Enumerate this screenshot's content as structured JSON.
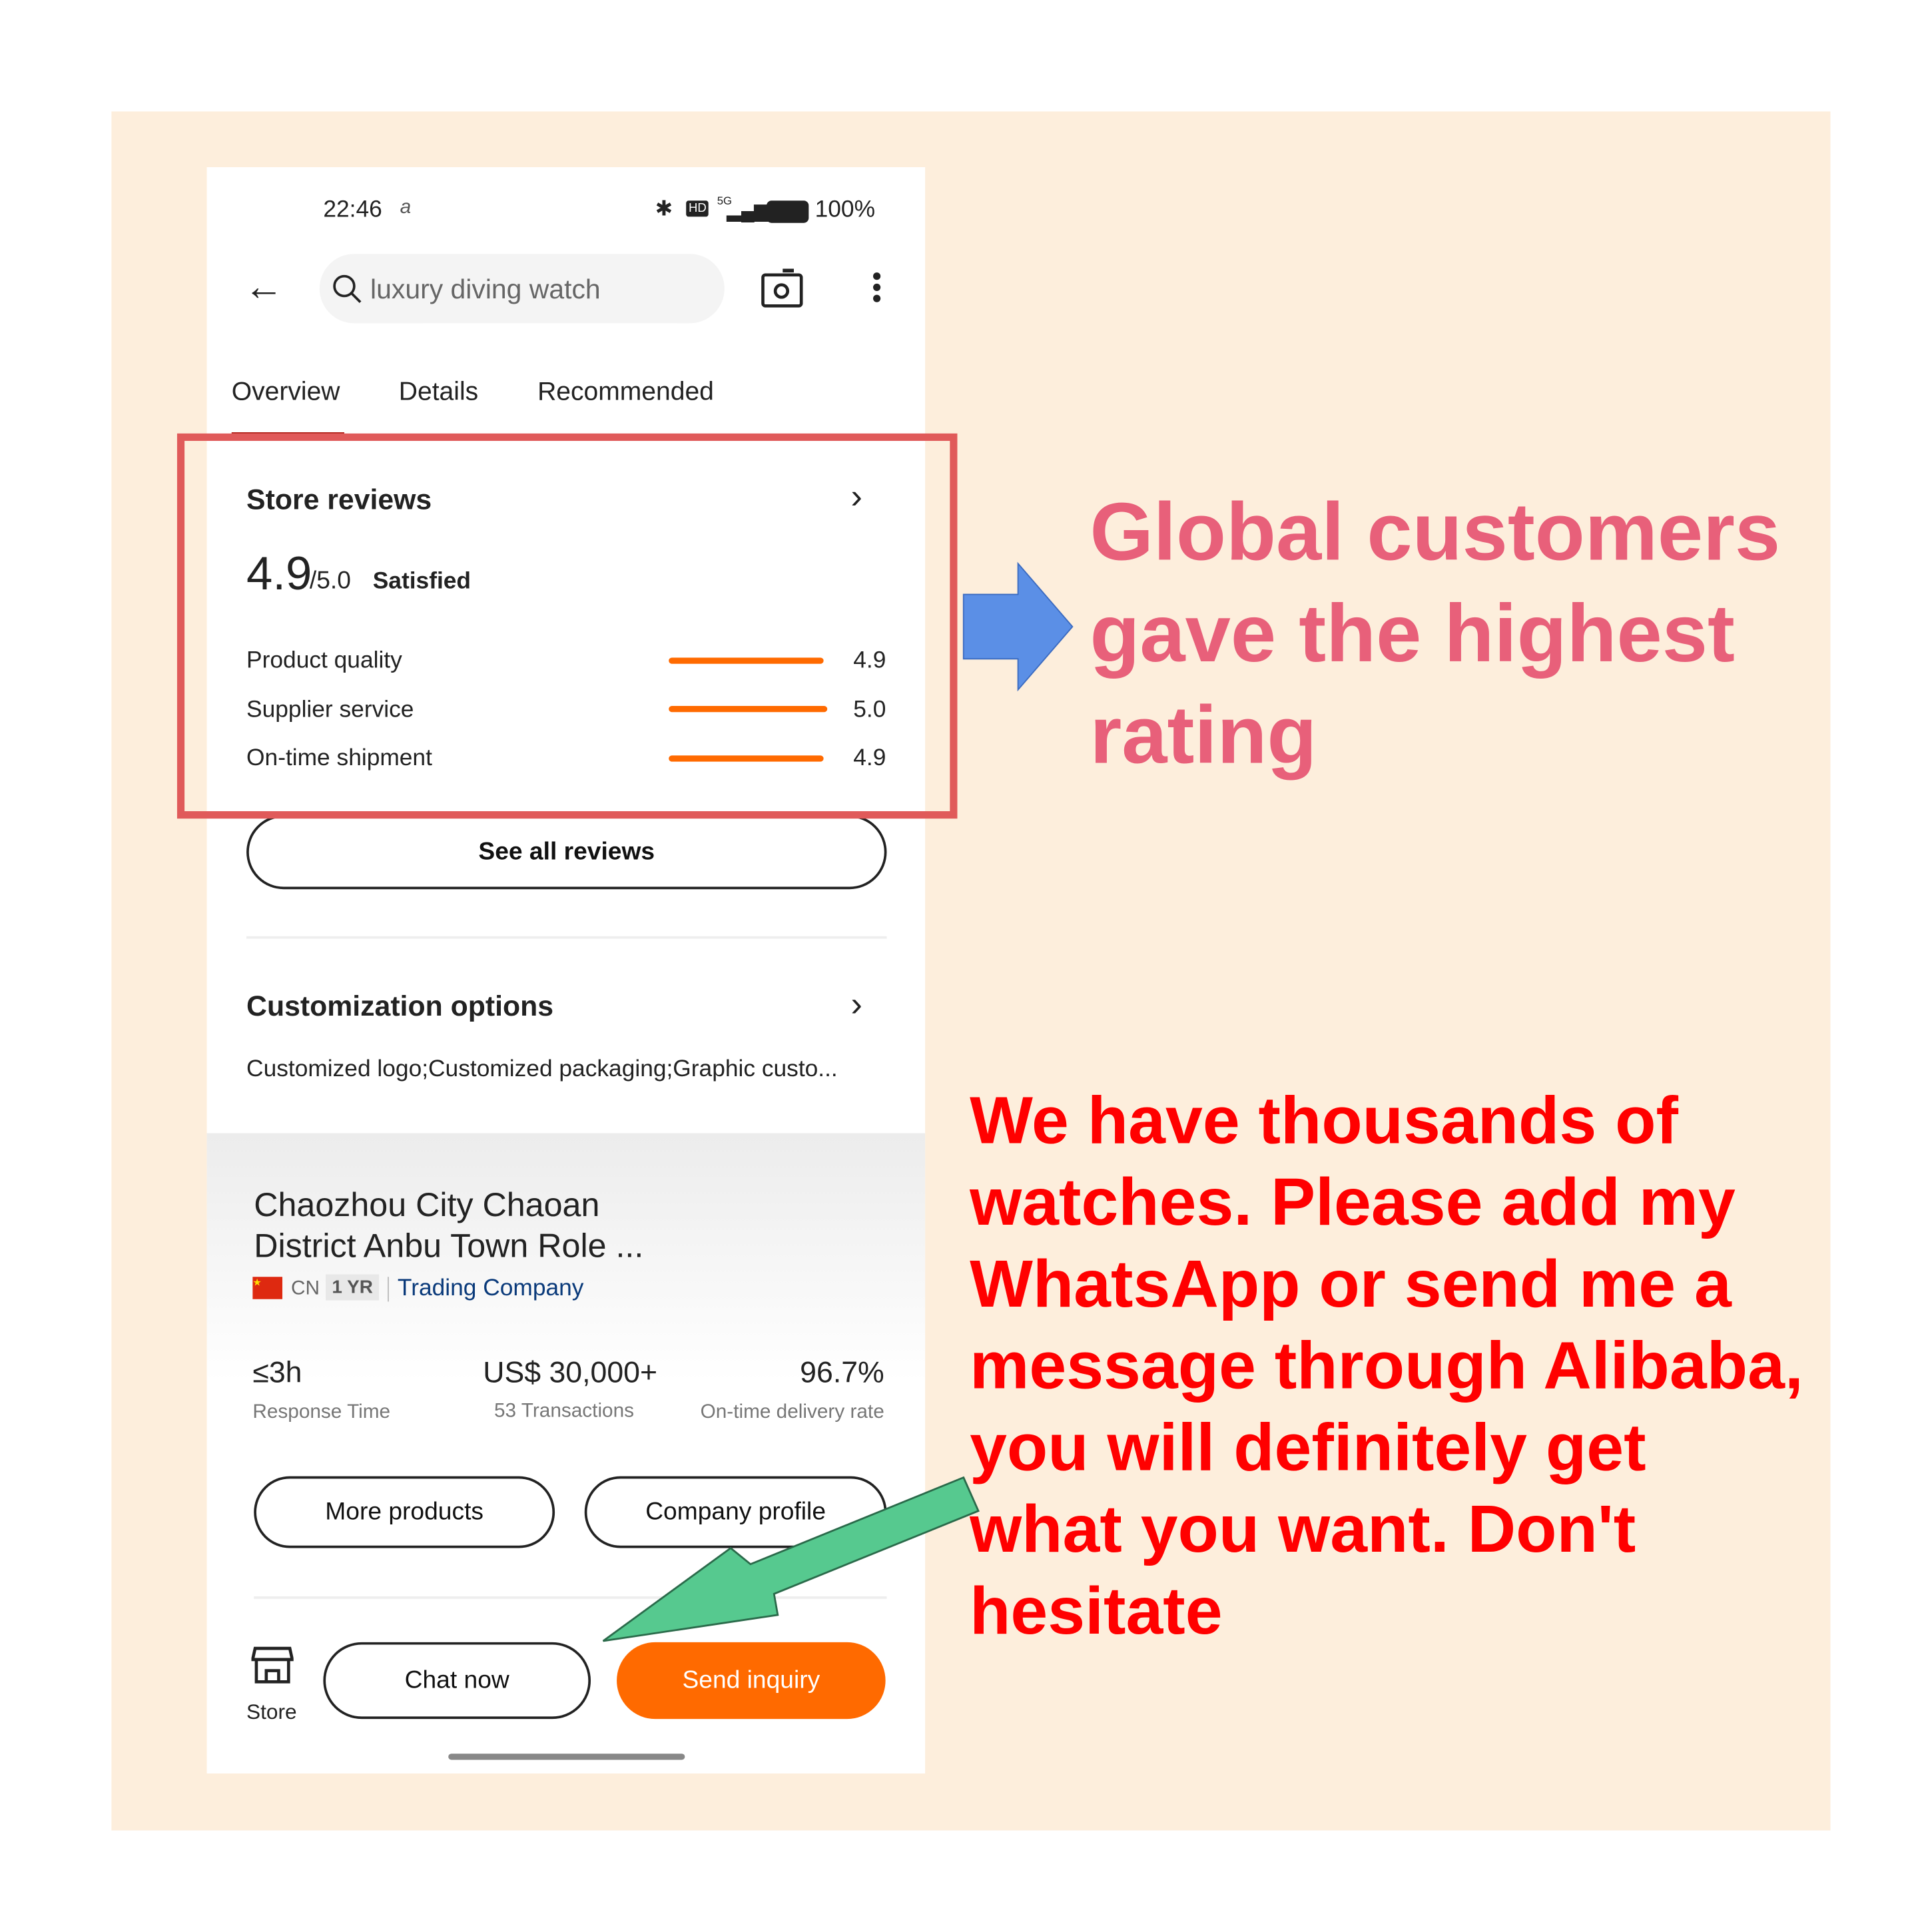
{
  "status": {
    "time": "22:46",
    "carrier_glyph": "a",
    "network": "5G",
    "battery": "100%"
  },
  "search": {
    "value": "luxury diving watch"
  },
  "tabs": [
    {
      "label": "Overview",
      "active": true
    },
    {
      "label": "Details"
    },
    {
      "label": "Recommended"
    }
  ],
  "reviews": {
    "title": "Store reviews",
    "score": "4.9",
    "max": "/5.0",
    "verdict": "Satisfied",
    "rows": [
      {
        "label": "Product quality",
        "value": "4.9",
        "fill": 0.98
      },
      {
        "label": "Supplier service",
        "value": "5.0",
        "fill": 1.0
      },
      {
        "label": "On-time shipment",
        "value": "4.9",
        "fill": 0.98
      }
    ],
    "see_all": "See all reviews"
  },
  "customization": {
    "title": "Customization options",
    "text": "Customized logo;Customized packaging;Graphic custo..."
  },
  "company": {
    "name_line1": "Chaozhou City Chaoan",
    "name_line2": "District Anbu Town Role ...",
    "country": "CN",
    "years": "1 YR",
    "type": "Trading Company",
    "stats": [
      {
        "value": "≤3h",
        "label": "Response Time"
      },
      {
        "value": "US$ 30,000+",
        "label": "53 Transactions"
      },
      {
        "value": "96.7%",
        "label": "On-time delivery rate"
      }
    ],
    "more_products": "More products",
    "company_profile": "Company profile"
  },
  "bottom": {
    "store": "Store",
    "chat": "Chat now",
    "inquiry": "Send inquiry"
  },
  "annotations": {
    "pink": [
      "Global customers",
      "gave the highest",
      "rating"
    ],
    "red": [
      "We have thousands of",
      "watches. Please add my",
      "WhatsApp or send me a",
      "message through Alibaba,",
      "you will definitely get",
      "what you want. Don't",
      "hesitate"
    ]
  },
  "colors": {
    "accent": "#ff6a00",
    "highlight_box": "#e05a5a",
    "pink_text": "#e8607a",
    "red_text": "#ff0000",
    "blue_arrow": "#5b8fe6",
    "green_arrow": "#56c98f",
    "link": "#0a3a7a"
  }
}
